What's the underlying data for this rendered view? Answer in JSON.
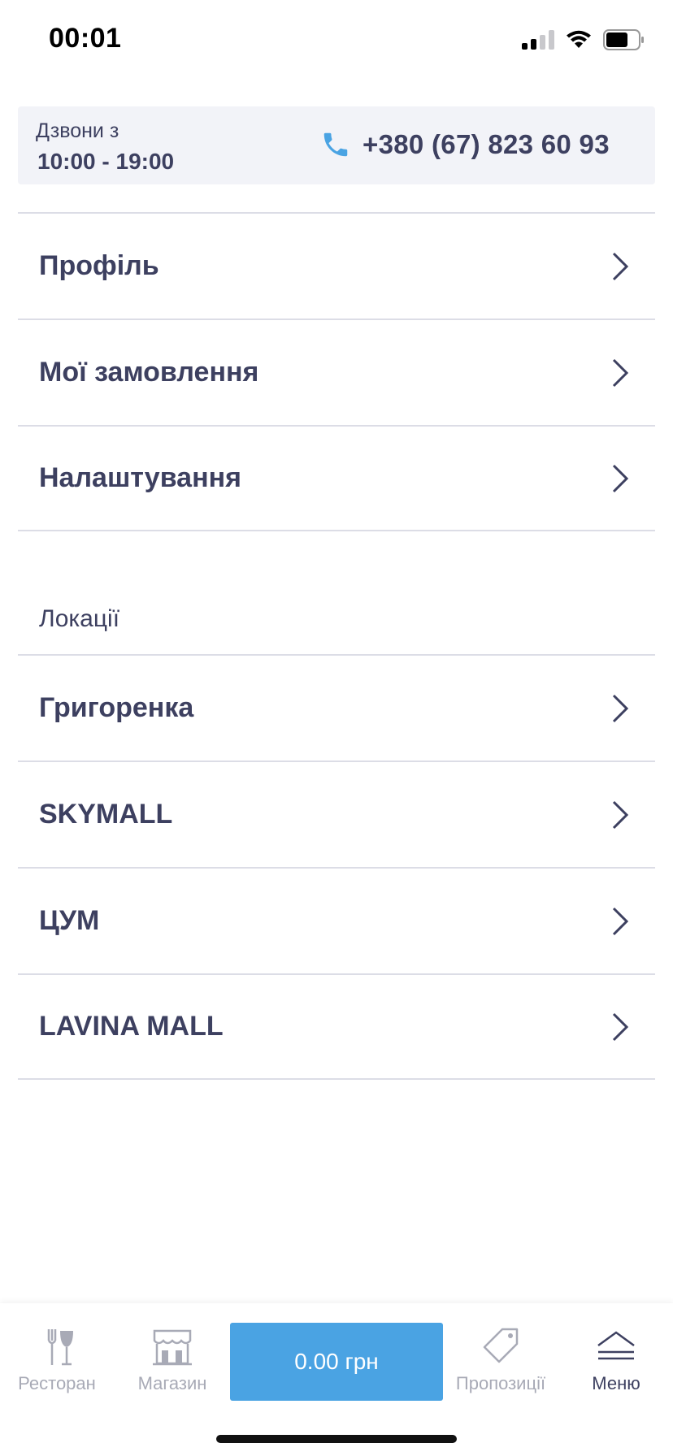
{
  "status": {
    "time": "00:01"
  },
  "call": {
    "label": "Дзвони з",
    "hours": "10:00 - 19:00",
    "phone": "+380 (67) 823 60 93",
    "icon": "phone-icon",
    "icon_color": "#4aa3e3"
  },
  "account_menu": [
    {
      "label": "Профіль"
    },
    {
      "label": "Мої замовлення"
    },
    {
      "label": "Налаштування"
    }
  ],
  "locations": {
    "title": "Локації",
    "items": [
      {
        "label": "Григоренка"
      },
      {
        "label": "SKYMALL"
      },
      {
        "label": "ЦУМ"
      },
      {
        "label": "LAVINA MALL"
      }
    ]
  },
  "tabbar": {
    "restaurant": "Ресторан",
    "shop": "Магазин",
    "cart": "0.00 грн",
    "offers": "Пропозиції",
    "menu": "Меню",
    "accent": "#4aa3e3",
    "active_tab": "menu"
  }
}
